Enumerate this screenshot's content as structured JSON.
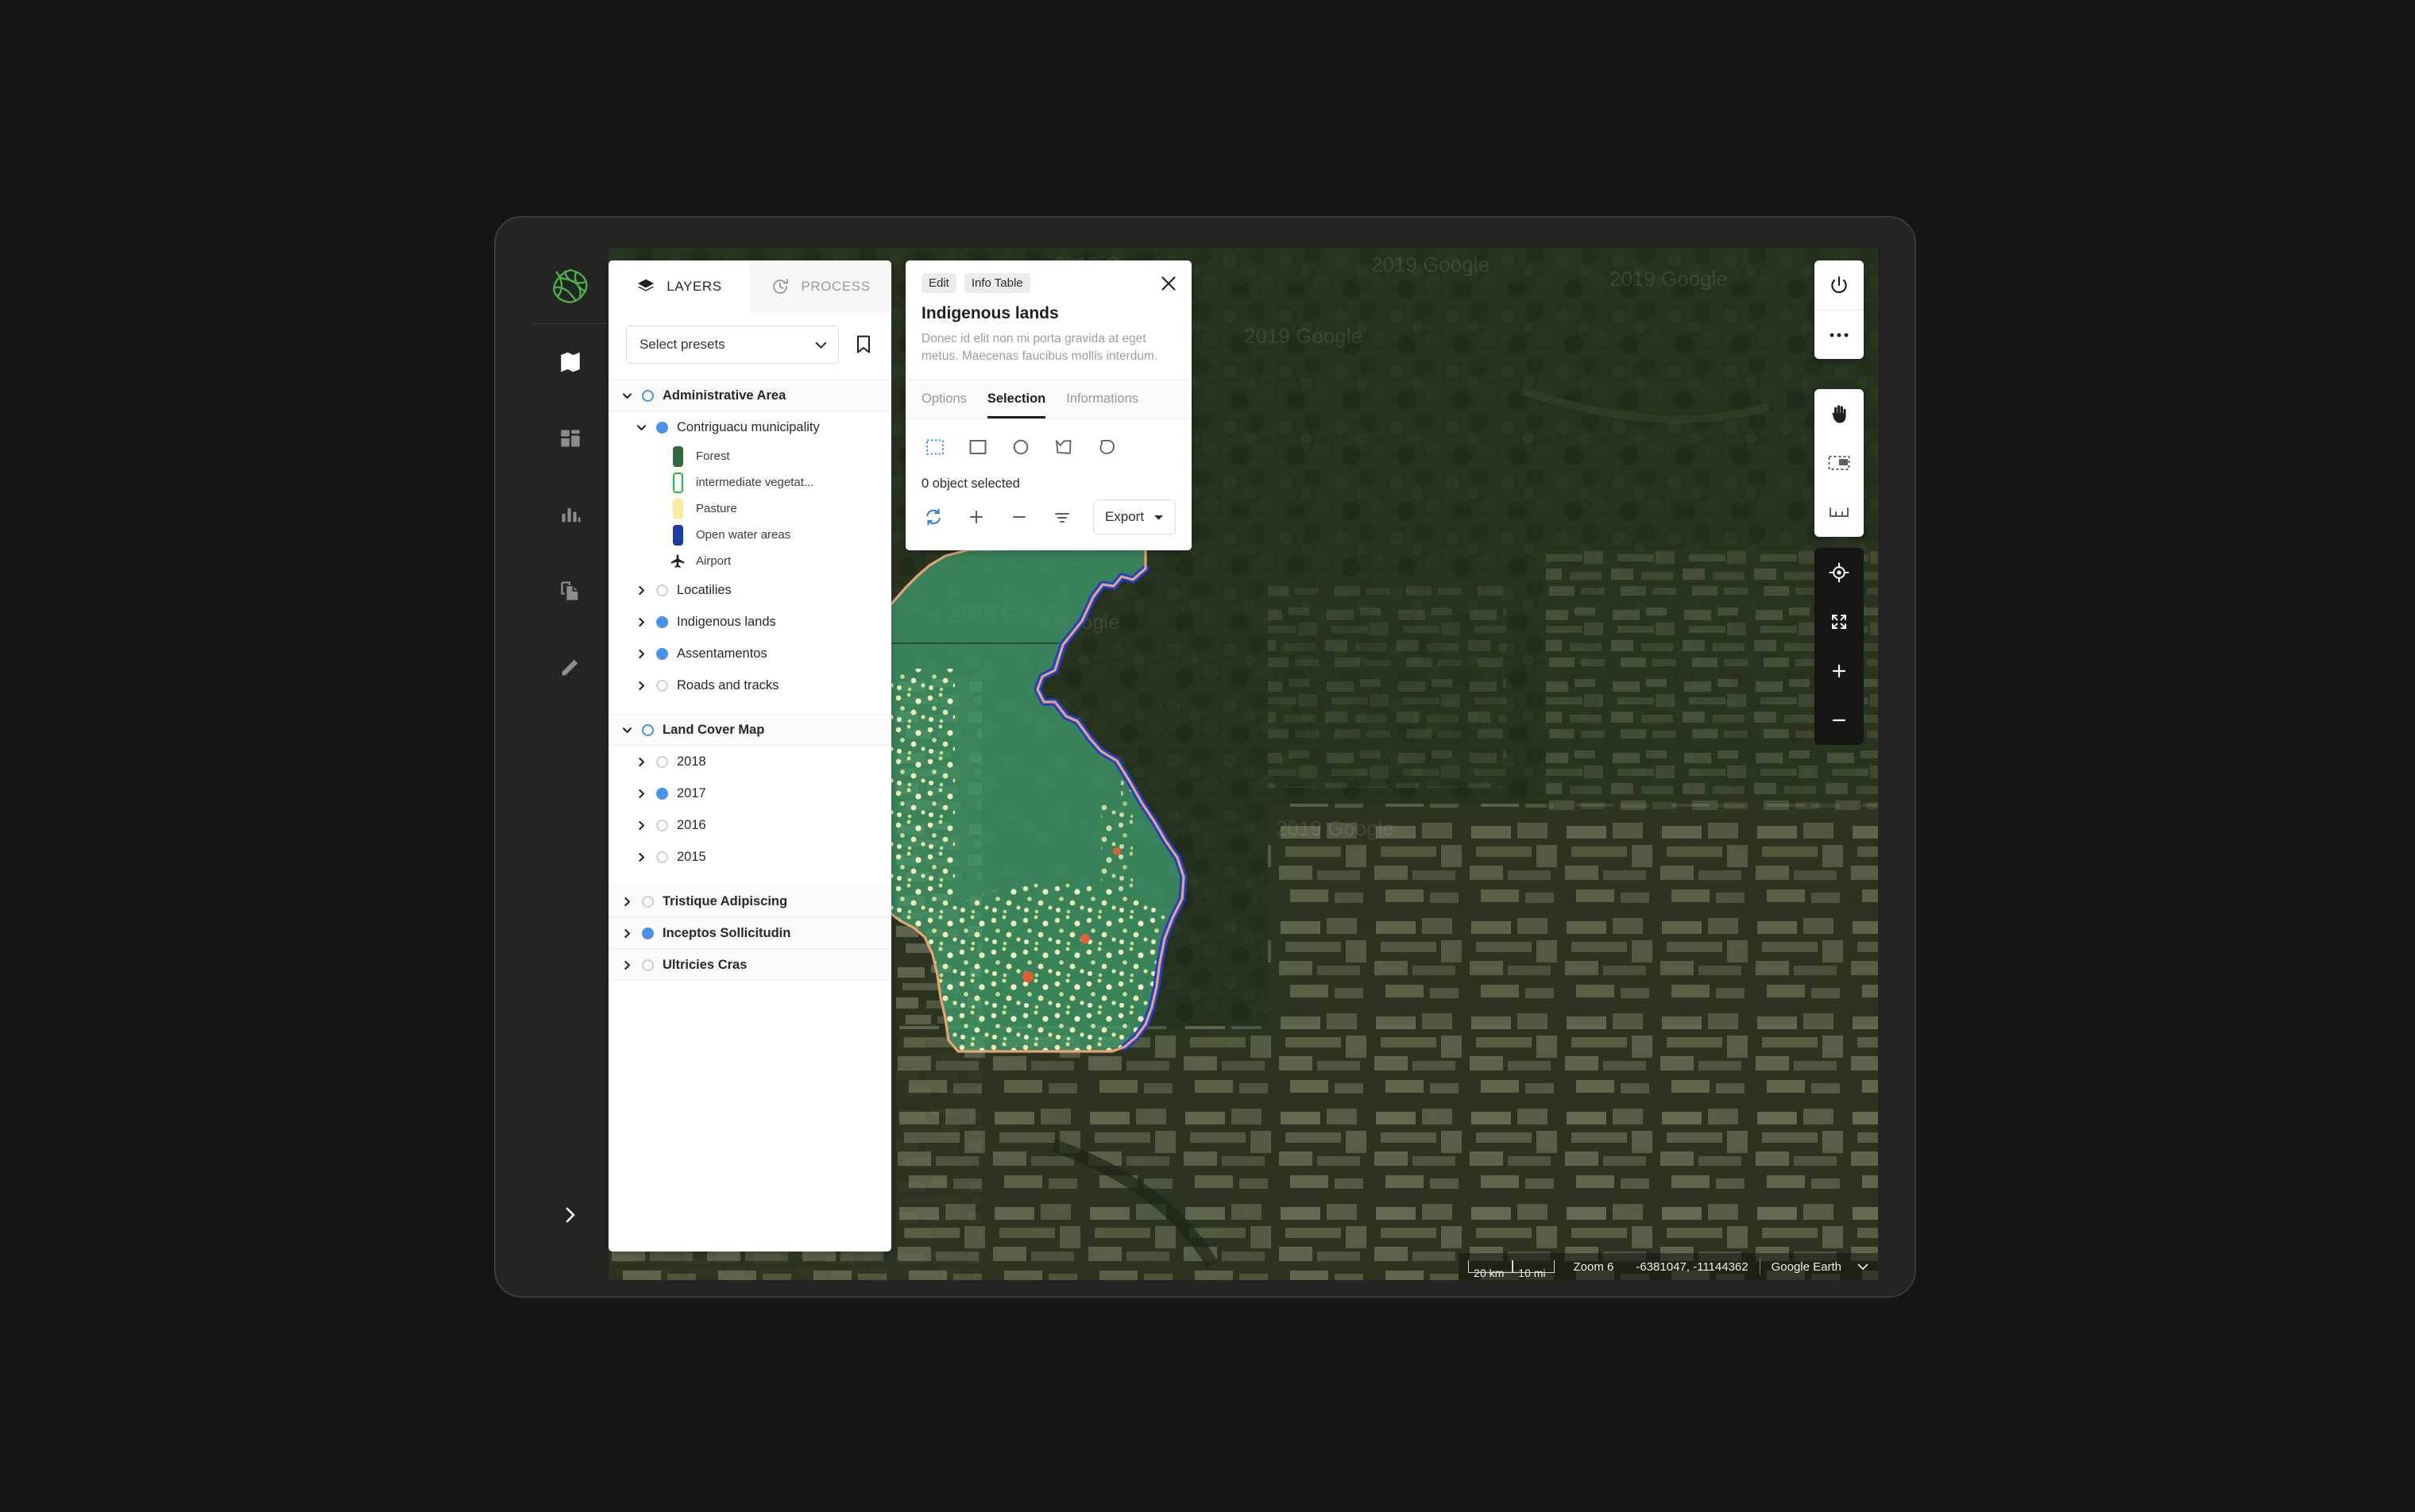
{
  "left_rail": {
    "logo_name": "app-logo",
    "logo_color": "#4caf4a",
    "items": [
      {
        "name": "map-icon",
        "active": true
      },
      {
        "name": "dashboard-grid-icon",
        "active": false
      },
      {
        "name": "bar-chart-icon",
        "active": false
      },
      {
        "name": "documents-icon",
        "active": false
      },
      {
        "name": "pencil-edit-icon",
        "active": false
      }
    ],
    "expand_label": "›"
  },
  "layers_panel": {
    "tabs": [
      {
        "label": "LAYERS",
        "icon": "layers-icon",
        "active": true
      },
      {
        "label": "PROCESS",
        "icon": "history-process-icon",
        "active": false
      }
    ],
    "preset_select": {
      "value": "Select presets",
      "placeholder": "Select presets"
    },
    "bookmark_icon": "bookmark-icon",
    "tree": [
      {
        "label": "Administrative Area",
        "type": "group",
        "expanded": true,
        "state": "ring",
        "children": [
          {
            "label": "Contriguacu municipality",
            "type": "layer",
            "expanded": true,
            "state": "on",
            "legend": [
              {
                "label": "Forest",
                "color": "#2d6b3c",
                "style": "solid"
              },
              {
                "label": "intermediate vegetat...",
                "color": "#22c03a",
                "style": "outline"
              },
              {
                "label": "Pasture",
                "color": "#f6eda0",
                "style": "solid"
              },
              {
                "label": "Open water areas",
                "color": "#1a3fa0",
                "style": "solid"
              },
              {
                "label": "Airport",
                "color": "#1d1f22",
                "style": "icon",
                "icon": "airplane-icon"
              }
            ]
          },
          {
            "label": "Locatilies",
            "type": "layer",
            "expanded": false,
            "state": "off"
          },
          {
            "label": "Indigenous lands",
            "type": "layer",
            "expanded": false,
            "state": "on"
          },
          {
            "label": "Assentamentos",
            "type": "layer",
            "expanded": false,
            "state": "on"
          },
          {
            "label": "Roads and tracks",
            "type": "layer",
            "expanded": false,
            "state": "off"
          }
        ]
      },
      {
        "label": "Land Cover Map",
        "type": "group",
        "expanded": true,
        "state": "ring",
        "children": [
          {
            "label": "2018",
            "type": "layer",
            "expanded": false,
            "state": "off"
          },
          {
            "label": "2017",
            "type": "layer",
            "expanded": false,
            "state": "on"
          },
          {
            "label": "2016",
            "type": "layer",
            "expanded": false,
            "state": "off"
          },
          {
            "label": "2015",
            "type": "layer",
            "expanded": false,
            "state": "off"
          }
        ]
      },
      {
        "label": "Tristique Adipiscing",
        "type": "group",
        "expanded": false,
        "state": "off",
        "children": []
      },
      {
        "label": "Inceptos Sollicitudin",
        "type": "group",
        "expanded": false,
        "state": "on",
        "children": []
      },
      {
        "label": "Ultricies Cras",
        "type": "group",
        "expanded": false,
        "state": "off",
        "children": []
      }
    ]
  },
  "info_panel": {
    "chips": [
      {
        "label": "Edit",
        "name": "edit-chip"
      },
      {
        "label": "Info Table",
        "name": "info-table-chip"
      }
    ],
    "close_icon": "close-icon",
    "title": "Indigenous lands",
    "description": "Donec id elit non mi porta gravida at eget metus. Maecenas faucibus mollis interdum.",
    "tabs": [
      {
        "label": "Options",
        "active": false
      },
      {
        "label": "Selection",
        "active": true
      },
      {
        "label": "Informations",
        "active": false
      }
    ],
    "selection_tools": [
      {
        "name": "marquee-select-icon",
        "active": true
      },
      {
        "name": "rectangle-select-icon",
        "active": false
      },
      {
        "name": "circle-select-icon",
        "active": false
      },
      {
        "name": "polygon-select-icon",
        "active": false
      },
      {
        "name": "lasso-select-icon",
        "active": false
      }
    ],
    "selection_count": "0 object selected",
    "actions": [
      {
        "name": "refresh-icon",
        "color": "#2f7ef0"
      },
      {
        "name": "plus-icon",
        "color": "#5d5f62"
      },
      {
        "name": "minus-icon",
        "color": "#5d5f62"
      },
      {
        "name": "filter-icon",
        "color": "#5d5f62"
      }
    ],
    "export_label": "Export",
    "export_caret": "caret-down-icon"
  },
  "map_tools": {
    "top": [
      {
        "name": "power-icon"
      },
      {
        "name": "more-horizontal-icon"
      }
    ],
    "middle": [
      {
        "name": "pan-hand-icon"
      },
      {
        "name": "select-area-icon"
      },
      {
        "name": "measure-icon"
      }
    ],
    "bottom": [
      {
        "name": "locate-target-icon"
      },
      {
        "name": "fullscreen-expand-icon"
      },
      {
        "name": "zoom-in-icon"
      },
      {
        "name": "zoom-out-icon"
      }
    ]
  },
  "status_bar": {
    "scale_km": "20 km",
    "scale_mi": "10 mi",
    "zoom": "Zoom 6",
    "coordinates": "-6381047, -11144362",
    "basemap": "Google Earth",
    "caret": "caret-down-icon"
  },
  "map": {
    "basemap_dark_green": "#27331f",
    "overlay_fill": "#3f9a6b",
    "boundary_orange": "#e8a472",
    "boundary_blue": "#1e3fd0",
    "attribution_ghost": "2019 Google"
  }
}
